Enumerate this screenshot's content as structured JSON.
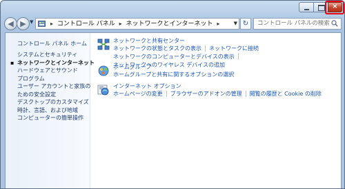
{
  "window": {
    "close_label": "×"
  },
  "nav": {
    "back_icon": "back-arrow-icon",
    "forward_icon": "forward-arrow-icon"
  },
  "address": {
    "crumbs": [
      "コントロール パネル",
      "ネットワークとインターネット"
    ],
    "separator": "▸"
  },
  "search": {
    "placeholder": "コントロール パネルの検索"
  },
  "sidebar": {
    "home": "コントロール パネル ホーム",
    "items": [
      {
        "label": "システムとセキュリティ",
        "current": false
      },
      {
        "label": "ネットワークとインターネット",
        "current": true
      },
      {
        "label": "ハードウェアとサウンド",
        "current": false
      },
      {
        "label": "プログラム",
        "current": false
      },
      {
        "label": "ユーザー アカウントと家族の",
        "current": false
      },
      {
        "label": "ための安全設定",
        "current": false
      },
      {
        "label": "デスクトップのカスタマイズ",
        "current": false
      },
      {
        "label": "時計、言語、および地域",
        "current": false
      },
      {
        "label": "コンピューターの簡単操作",
        "current": false
      }
    ]
  },
  "categories": [
    {
      "title": "ネットワークと共有センター",
      "icon": "network-center-icon",
      "lines": [
        [
          "ネットワークの状態とタスクの表示",
          "ネットワークに接続"
        ],
        [
          "ネットワークのコンピューターとデバイスの表示",
          "ネットワークへのワイヤレス デバイスの追加"
        ]
      ]
    },
    {
      "title": "ホームグループ",
      "icon": "homegroup-icon",
      "lines": [
        [
          "ホームグループと共有に関するオプションの選択"
        ]
      ]
    },
    {
      "title": "インターネット オプション",
      "icon": "internet-options-icon",
      "lines": [
        [
          "ホームページの変更",
          "ブラウザーのアドオンの管理",
          "閲覧の履歴と Cookie の削除"
        ]
      ]
    }
  ],
  "colors": {
    "link": "#1a55b8",
    "close_highlight": "#e60012"
  }
}
